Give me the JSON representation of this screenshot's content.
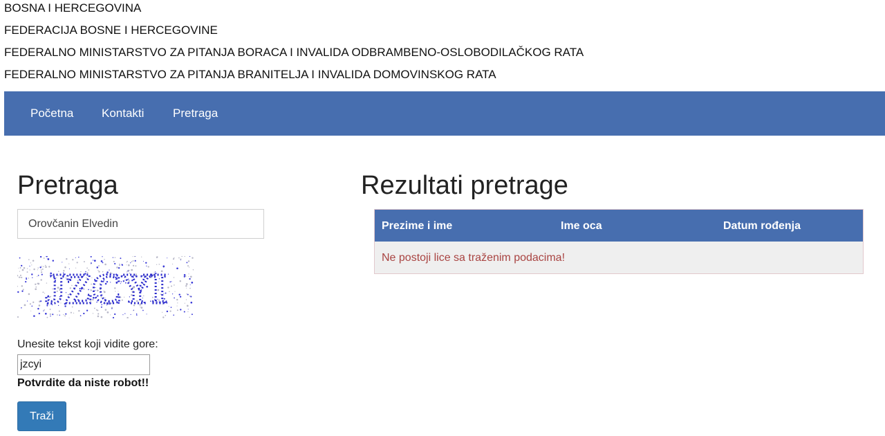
{
  "header": {
    "lines": [
      "BOSNA I HERCEGOVINA",
      "FEDERACIJA BOSNE I HERCEGOVINE",
      "FEDERALNO MINISTARSTVO ZA PITANJA BORACA I INVALIDA ODBRAMBENO-OSLOBODILAČKOG RATA",
      "FEDERALNO MINISTARSTVO ZA PITANJA BRANITELJA I INVALIDA DOMOVINSKOG RATA"
    ]
  },
  "nav": {
    "items": [
      "Početna",
      "Kontakti",
      "Pretraga"
    ],
    "background": "#476eaf"
  },
  "search": {
    "title": "Pretraga",
    "query_value": "Orovčanin Elvedin",
    "captcha_text": "JZCYI",
    "captcha_label": "Unesite tekst koji vidite gore:",
    "captcha_value": "jzcyi",
    "robot_message": "Potvrdite da niste robot!!",
    "submit_label": "Traži",
    "button_color": "#337ab7"
  },
  "results": {
    "title": "Rezultati pretrage",
    "columns": [
      "Prezime i ime",
      "Ime oca",
      "Datum rođenja"
    ],
    "empty_message": "Ne postoji lice sa traženim podacima!",
    "error_color": "#a94442"
  }
}
